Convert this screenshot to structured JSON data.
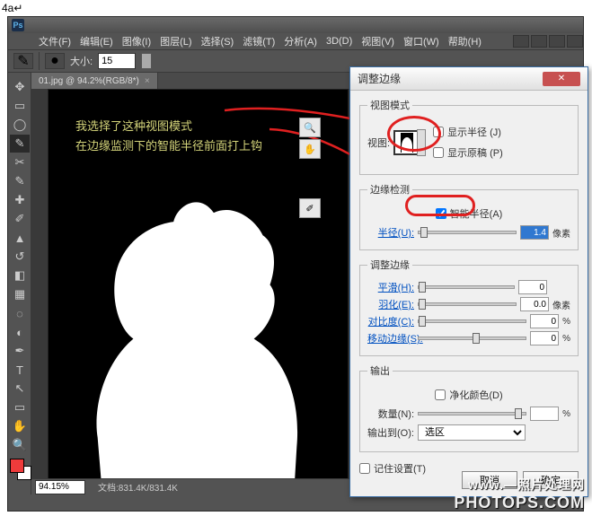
{
  "step": "4a↵",
  "menu": {
    "file": "文件(F)",
    "edit": "编辑(E)",
    "image": "图像(I)",
    "layer": "图层(L)",
    "select": "选择(S)",
    "filter": "滤镜(T)",
    "analysis": "分析(A)",
    "threed": "3D(D)",
    "view": "视图(V)",
    "window": "窗口(W)",
    "help": "帮助(H)"
  },
  "optbar": {
    "size_label": "大小:",
    "size_value": "15"
  },
  "doc": {
    "tab_title": "01.jpg @ 94.2%(RGB/8*)"
  },
  "annotations": {
    "a1": "我选择了这种视图模式",
    "a2": "在边缘监测下的智能半径前面打上钩"
  },
  "dialog": {
    "title": "调整边缘",
    "viewmode": {
      "legend": "视图模式",
      "view_label": "视图:",
      "show_radius": "显示半径 (J)",
      "show_original": "显示原稿 (P)"
    },
    "edgedetect": {
      "legend": "边缘检测",
      "smart_radius": "智能半径(A)",
      "radius_label": "半径(U):",
      "radius_value": "1.4",
      "radius_unit": "像素"
    },
    "adjust": {
      "legend": "调整边缘",
      "smooth_label": "平滑(H):",
      "smooth_value": "0",
      "feather_label": "羽化(E):",
      "feather_value": "0.0",
      "feather_unit": "像素",
      "contrast_label": "对比度(C):",
      "contrast_value": "0",
      "contrast_unit": "%",
      "shift_label": "移动边缘(S):",
      "shift_value": "0",
      "shift_unit": "%"
    },
    "output": {
      "legend": "输出",
      "decontaminate": "净化颜色(D)",
      "amount_label": "数量(N):",
      "amount_unit": "%",
      "output_to_label": "输出到(O):",
      "output_to_value": "选区"
    },
    "remember": "记住设置(T)",
    "ok": "确定",
    "cancel": "取消"
  },
  "status": {
    "zoom": "94.15%",
    "docinfo": "文档:831.4K/831.4K"
  },
  "watermark": {
    "l1": "www.—照片处理网",
    "l2": "PHOTOPS.COM"
  }
}
